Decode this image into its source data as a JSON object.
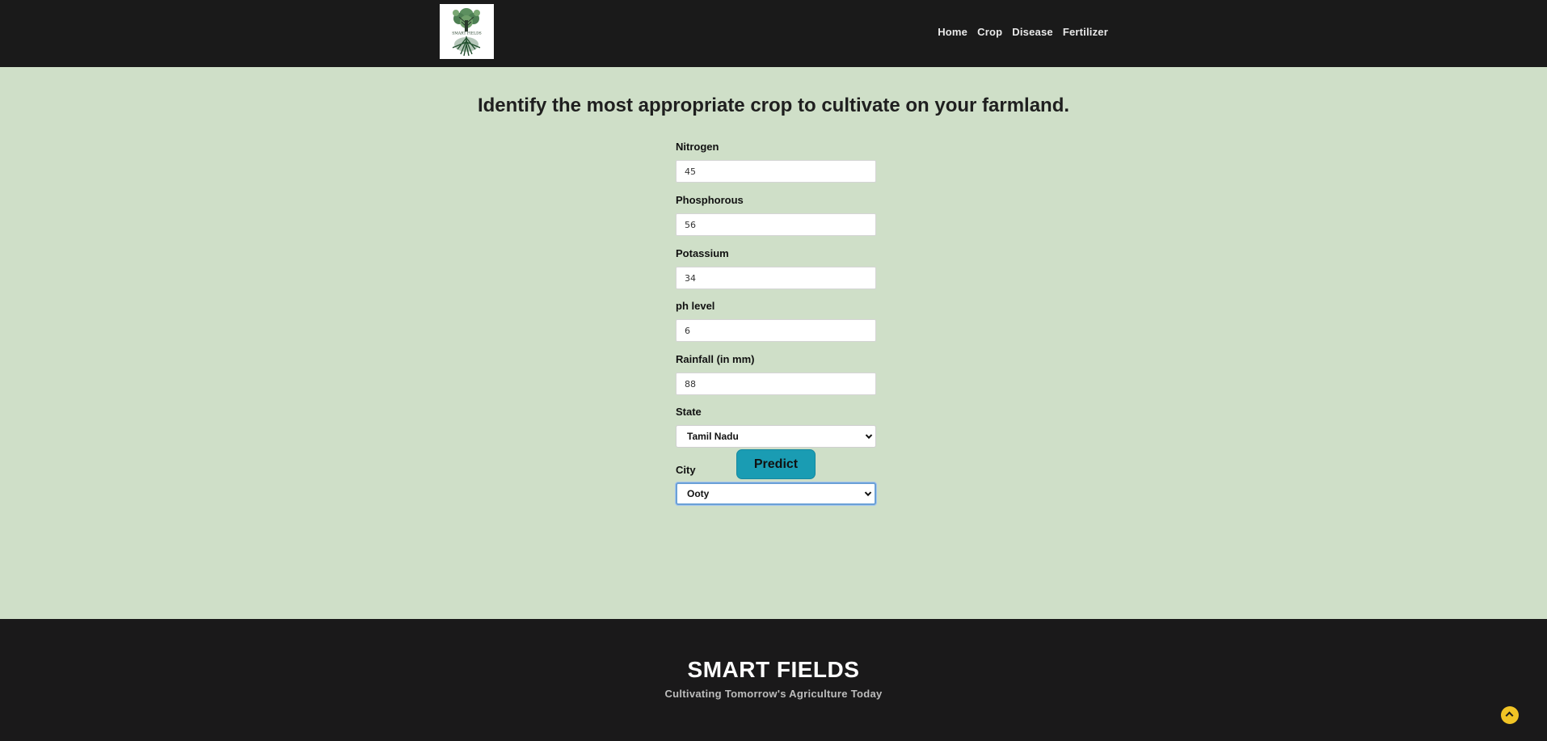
{
  "header": {
    "logo_text": "SMART FIELDS",
    "nav": [
      {
        "label": "Home"
      },
      {
        "label": "Crop"
      },
      {
        "label": "Disease"
      },
      {
        "label": "Fertilizer"
      }
    ]
  },
  "main": {
    "title": "Identify the most appropriate crop to cultivate on your farmland.",
    "fields": {
      "nitrogen": {
        "label": "Nitrogen",
        "value": "45"
      },
      "phosphorous": {
        "label": "Phosphorous",
        "value": "56"
      },
      "potassium": {
        "label": "Potassium",
        "value": "34"
      },
      "ph": {
        "label": "ph level",
        "value": "6"
      },
      "rainfall": {
        "label": "Rainfall (in mm)",
        "value": "88"
      },
      "state": {
        "label": "State",
        "selected": "Tamil Nadu"
      },
      "city": {
        "label": "City",
        "selected": "Ooty"
      }
    },
    "predict_label": "Predict"
  },
  "footer": {
    "title": "SMART FIELDS",
    "tagline": "Cultivating Tomorrow's Agriculture Today"
  },
  "colors": {
    "nav_bg": "#1a1a1a",
    "page_bg": "#cfdfc8",
    "button_bg": "#1a9cb3",
    "footer_bg": "#1a191a",
    "scroll_top": "#f1c425"
  },
  "icons": {
    "logo": "tree-logo-icon",
    "scroll_top": "chevron-up-icon",
    "select": "chevron-down-icon"
  }
}
